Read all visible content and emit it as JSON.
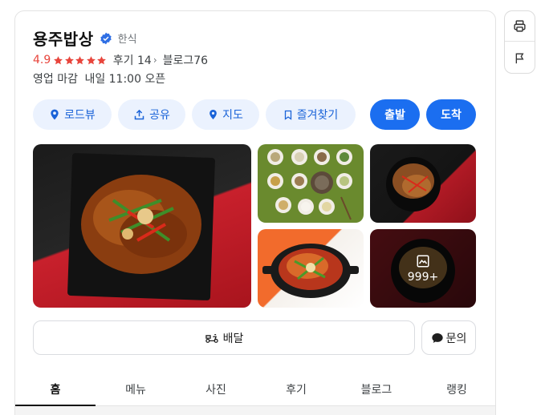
{
  "place": {
    "name": "용주밥상",
    "category": "한식",
    "rating": "4.9",
    "stars": 5,
    "review_label": "후기",
    "review_count": "14",
    "blog_label": "블로그",
    "blog_count": "76",
    "status": "영업 마감",
    "next_open": "내일 11:00 오픈"
  },
  "actions": {
    "roadview": "로드뷰",
    "share": "공유",
    "map": "지도",
    "favorite": "즐겨찾기",
    "depart": "출발",
    "arrive": "도착"
  },
  "photos": {
    "more_count": "999+"
  },
  "service": {
    "delivery": "배달",
    "inquiry": "문의"
  },
  "tabs": [
    "홈",
    "메뉴",
    "사진",
    "후기",
    "블로그",
    "랭킹"
  ],
  "colors": {
    "accent": "#1b6ef0",
    "accent_soft": "#ebf2fe",
    "rating": "#e8453c"
  },
  "icons": {
    "print": "print-icon",
    "report": "flag-icon",
    "verified": "verified-badge-icon"
  }
}
